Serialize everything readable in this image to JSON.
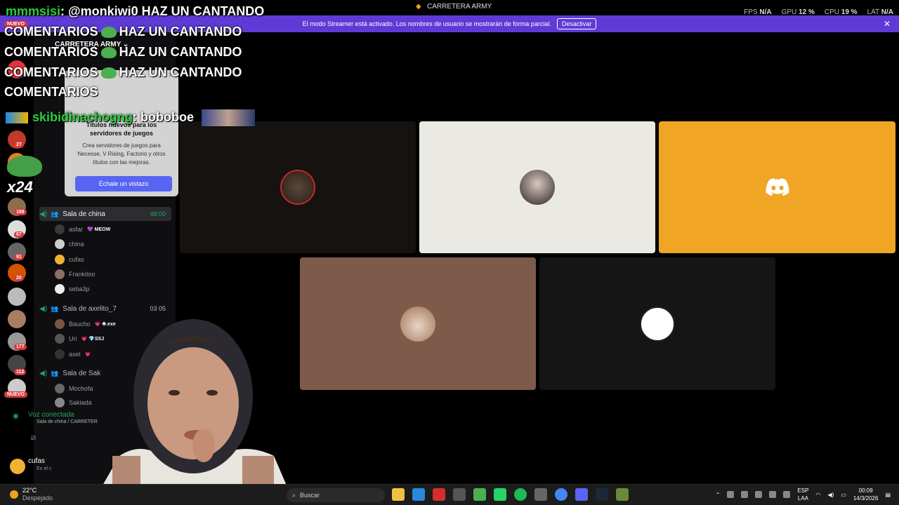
{
  "titlebar": {
    "title": "CARRETERA ARMY",
    "fps_label": "FPS",
    "fps_value": "N/A",
    "gpu_label": "GPU",
    "gpu_value": "12 %",
    "cpu_label": "CPU",
    "cpu_value": "19 %",
    "lat_label": "LAT",
    "lat_value": "N/A"
  },
  "banner": {
    "text": "El modo Streamer está activado. Los nombres de usuario se mostrarán de forma parcial.",
    "button": "Desactivar",
    "close": "✕"
  },
  "rail": {
    "nuevo_top": "NUEVO",
    "nuevo_bottom": "NUEVO",
    "badges": [
      "27",
      "2",
      "189",
      "67",
      "91",
      "20",
      "177",
      "112"
    ]
  },
  "sidebar": {
    "server_name": "CARRETERA ARMY ⌄",
    "popup": {
      "title": "Títulos nuevos para los servidores de juegos",
      "body": "Crea servidores de juegos para Necesse, V Rising, Factorio y otros títulos con las mejoras.",
      "button": "Échale un vistazo",
      "close": "✕"
    },
    "channels": [
      {
        "name": "Sala de china",
        "timer": "48:00",
        "members": [
          {
            "name": "asfar",
            "tag": "💜 MEOW"
          },
          {
            "name": "china",
            "tag": ""
          },
          {
            "name": "cufas",
            "tag": ""
          },
          {
            "name": "Frankitoo",
            "tag": ""
          },
          {
            "name": "seba3p",
            "tag": ""
          }
        ]
      },
      {
        "name": "Sala de axelito_7",
        "count": "03  05",
        "members": [
          {
            "name": "Baucho",
            "tag": "💗 ✤.exe"
          },
          {
            "name": "Uri",
            "tag": "💗 💎SSJ"
          },
          {
            "name": "axel",
            "tag": "💗"
          }
        ]
      },
      {
        "name": "Sala de Sak",
        "members": [
          {
            "name": "Mochofa",
            "tag": ""
          },
          {
            "name": "Sakiada",
            "tag": ""
          }
        ]
      }
    ],
    "voice": {
      "status": "Voz conectada",
      "sub": "Sala de china / CARRETER"
    },
    "user": {
      "name": "cufas",
      "status": "En el c"
    }
  },
  "chat": {
    "lines": [
      {
        "user": "mmmsisi",
        "text": ": @monkiwi0 HAZ UN CANTANDO"
      },
      {
        "user": "",
        "text": "COMENTARIOS",
        "text2": "HAZ UN CANTANDO"
      },
      {
        "user": "",
        "text": "COMENTARIOS",
        "text2": "HAZ UN CANTANDO"
      },
      {
        "user": "",
        "text": "COMENTARIOS",
        "text2": "HAZ UN CANTANDO"
      },
      {
        "user": "",
        "text": "COMENTARIOS",
        "text2": ""
      },
      {
        "user": "skibidinachogng",
        "text": ": boboboe"
      }
    ],
    "x24": "x24"
  },
  "taskbar": {
    "temp": "22°C",
    "weather": "Despejado",
    "search": "Buscar",
    "lang1": "ESP",
    "lang2": "LAA",
    "time": "00:09",
    "date": "14/3/2026"
  },
  "colors": {
    "banner": "#5f3bd6",
    "discord_orange": "#f0a524",
    "tile_light": "#ebe9e4",
    "tile_brown": "#7d5a4a",
    "tile_dark": "#151210"
  }
}
